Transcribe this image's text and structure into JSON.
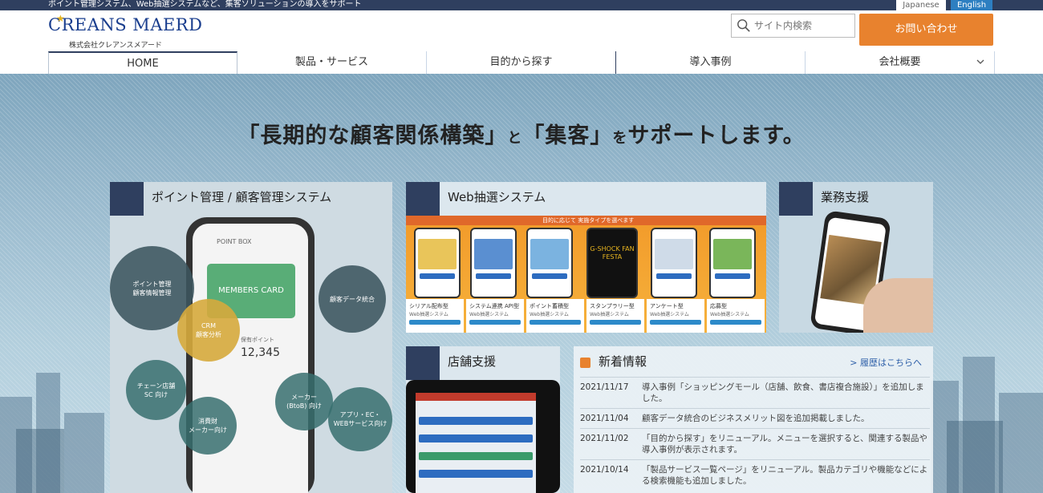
{
  "topbar": {
    "tagline": "ポイント管理システム、Web抽選システムなど、集客ソリューションの導入をサポート",
    "lang_ja": "Japanese",
    "lang_en": "English"
  },
  "header": {
    "logo_text": "CREANS MAERD",
    "company_name": "株式会社クレアンスメアード",
    "search_placeholder": "サイト内検索",
    "contact_label": "お問い合わせ"
  },
  "nav": {
    "items": [
      {
        "label": "HOME"
      },
      {
        "label": "製品・サービス"
      },
      {
        "label": "目的から探す"
      },
      {
        "label": "導入事例"
      },
      {
        "label": "会社概要"
      }
    ]
  },
  "hero": {
    "tagline_part1": "「長期的な顧客関係構築」",
    "tagline_and1": "と",
    "tagline_part2": "「集客」",
    "tagline_and2": "を",
    "tagline_part3": "サポートします。"
  },
  "panels": {
    "point": {
      "title": "ポイント管理 / 顧客管理システム",
      "app_name": "POINT BOX",
      "card_label": "MEMBERS CARD",
      "points_label": "保有ポイント",
      "points_value": "12,345",
      "bubbles": {
        "b1": "ポイント管理\n顧客情報管理",
        "b2": "CRM\n顧客分析",
        "b3": "顧客データ統合",
        "b4": "チェーン店舗\nSC 向け",
        "b5": "消費財\nメーカー向け",
        "b6": "メーカー\n(BtoB) 向け",
        "b7": "アプリ・EC・\nWEBサービス向け"
      }
    },
    "web": {
      "title": "Web抽選システム",
      "banner": "目的に応じて 実施タイプを選べます",
      "cards": [
        {
          "name": "シリアル配布型",
          "sub": "Web抽選システム"
        },
        {
          "name": "システム連携 API型",
          "sub": "Web抽選システム"
        },
        {
          "name": "ポイント蓄積型",
          "sub": "Web抽選システム"
        },
        {
          "name": "スタンプラリー型",
          "sub": "Web抽選システム"
        },
        {
          "name": "アンケート型",
          "sub": "Web抽選システム"
        },
        {
          "name": "応募型",
          "sub": "Web抽選システム"
        }
      ],
      "promo": "G-SHOCK FAN FESTA"
    },
    "business": {
      "title": "業務支援"
    },
    "store": {
      "title": "店舗支援"
    }
  },
  "news": {
    "title": "新着情報",
    "archive_link": "> 履歴はこちらへ",
    "items": [
      {
        "date": "2021/11/17",
        "text": "導入事例「ショッピングモール（店舗、飲食、書店複合施設）」を追加しました。"
      },
      {
        "date": "2021/11/04",
        "text": "顧客データ統合のビジネスメリット図を追加掲載しました。"
      },
      {
        "date": "2021/11/02",
        "text": "「目的から探す」をリニューアル。メニューを選択すると、関連する製品や導入事例が表示されます。"
      },
      {
        "date": "2021/10/14",
        "text": "「製品サービス一覧ページ」をリニューアル。製品カテゴリや機能などによる検索機能も追加しました。"
      }
    ]
  },
  "colors": {
    "navy": "#2f3f5f",
    "accent_orange": "#e8822e",
    "link_blue": "#2d5fa8",
    "english_blue": "#2d7fc1"
  }
}
